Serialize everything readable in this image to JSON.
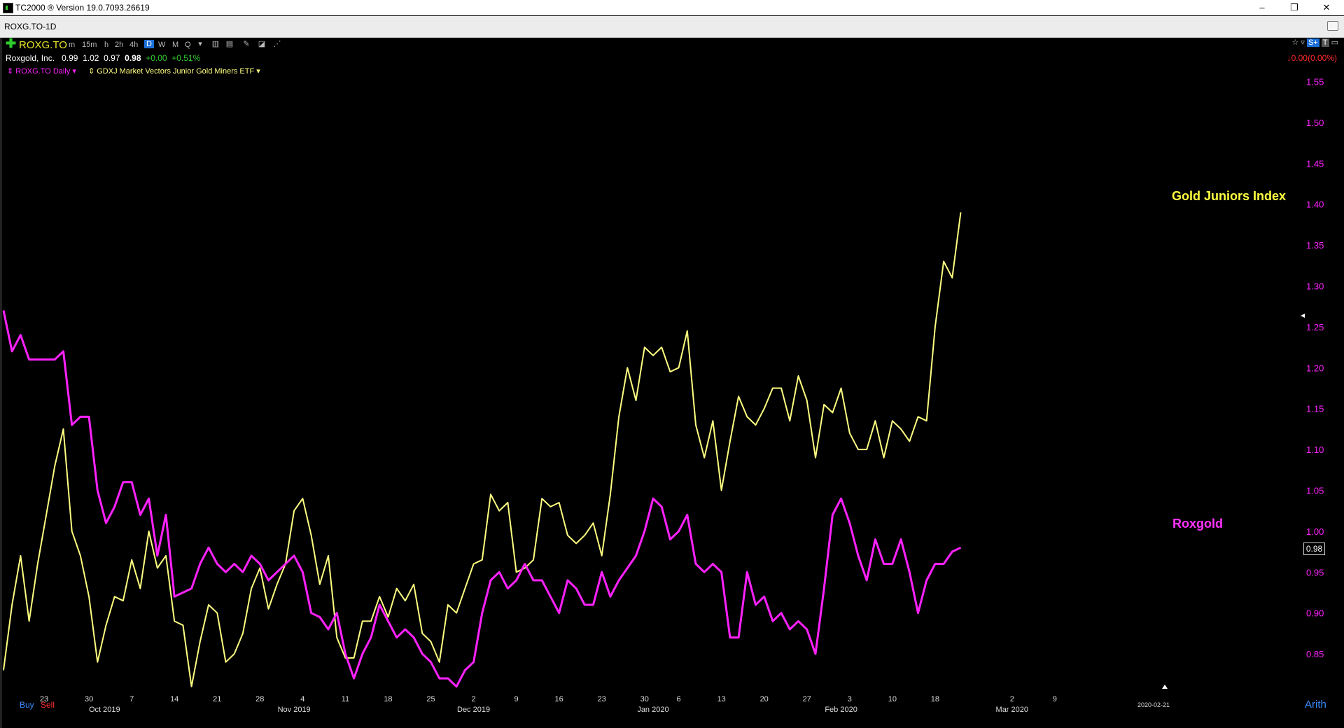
{
  "window": {
    "title": "TC2000 ® Version 19.0.7093.26619",
    "controls": [
      "–",
      "❐",
      "✕"
    ]
  },
  "tab": {
    "label": "ROXG.TO-1D"
  },
  "toolbar": {
    "symbol": "ROXG.TO",
    "timeframes": [
      "m",
      "15m",
      "h",
      "2h",
      "4h",
      "D",
      "W",
      "M",
      "Q"
    ],
    "active_timeframe": "D"
  },
  "quote": {
    "name": "Roxgold, Inc.",
    "open": "0.99",
    "high": "1.02",
    "low": "0.97",
    "last": "0.98",
    "change": "+0.00",
    "change_pct": "+0.51%",
    "neg_change": "↓0.00(0.00%)"
  },
  "legend": {
    "series1": "ROXG.TO Daily",
    "series2": "GDXJ Market Vectors Junior Gold Miners ETF"
  },
  "annotations": {
    "gold_label": "Gold Juniors Index",
    "rox_label": "Roxgold",
    "price_box": "0.98",
    "date_marker": "2020-02-21"
  },
  "footer": {
    "buy": "Buy",
    "sell": "Sell",
    "scale": "Arith"
  },
  "colors": {
    "roxgold": "#ff22ff",
    "gdxj": "#ffff80",
    "background": "#000000",
    "gold_label": "#ffff40"
  },
  "chart_data": {
    "type": "line",
    "ylim": [
      0.8,
      1.58
    ],
    "y_ticks": [
      "1.55",
      "1.50",
      "1.45",
      "1.40",
      "1.35",
      "1.30",
      "1.25",
      "1.20",
      "1.15",
      "1.10",
      "1.05",
      "1.00",
      "0.95",
      "0.90",
      "0.85"
    ],
    "x_tick_labels": [
      {
        "label": "23",
        "i": 5
      },
      {
        "label": "30",
        "i": 10
      },
      {
        "label": "7",
        "i": 15
      },
      {
        "label": "14",
        "i": 20
      },
      {
        "label": "21",
        "i": 25
      },
      {
        "label": "28",
        "i": 30
      },
      {
        "label": "4",
        "i": 35
      },
      {
        "label": "11",
        "i": 40
      },
      {
        "label": "18",
        "i": 45
      },
      {
        "label": "25",
        "i": 50
      },
      {
        "label": "2",
        "i": 55
      },
      {
        "label": "9",
        "i": 60
      },
      {
        "label": "16",
        "i": 65
      },
      {
        "label": "23",
        "i": 70
      },
      {
        "label": "30",
        "i": 75
      },
      {
        "label": "6",
        "i": 79
      },
      {
        "label": "13",
        "i": 84
      },
      {
        "label": "20",
        "i": 89
      },
      {
        "label": "27",
        "i": 94
      },
      {
        "label": "3",
        "i": 99
      },
      {
        "label": "10",
        "i": 104
      },
      {
        "label": "18",
        "i": 109
      },
      {
        "label": "2",
        "i": 118
      },
      {
        "label": "9",
        "i": 123
      }
    ],
    "month_labels": [
      {
        "label": "Oct 2019",
        "i": 11
      },
      {
        "label": "Nov 2019",
        "i": 34
      },
      {
        "label": "Dec 2019",
        "i": 55
      },
      {
        "label": "Jan 2020",
        "i": 76
      },
      {
        "label": "Feb 2020",
        "i": 98
      },
      {
        "label": "Mar 2020",
        "i": 118
      }
    ],
    "series": [
      {
        "name": "ROXG.TO Daily",
        "color": "#ff22ff",
        "values": [
          1.27,
          1.22,
          1.24,
          1.21,
          1.21,
          1.21,
          1.21,
          1.22,
          1.13,
          1.14,
          1.14,
          1.05,
          1.01,
          1.03,
          1.06,
          1.06,
          1.02,
          1.04,
          0.97,
          1.02,
          0.92,
          0.925,
          0.93,
          0.96,
          0.98,
          0.96,
          0.95,
          0.96,
          0.95,
          0.97,
          0.96,
          0.94,
          0.95,
          0.96,
          0.97,
          0.95,
          0.9,
          0.895,
          0.88,
          0.9,
          0.85,
          0.82,
          0.85,
          0.87,
          0.91,
          0.89,
          0.87,
          0.88,
          0.87,
          0.85,
          0.84,
          0.82,
          0.82,
          0.81,
          0.83,
          0.84,
          0.9,
          0.94,
          0.95,
          0.93,
          0.94,
          0.96,
          0.94,
          0.94,
          0.92,
          0.9,
          0.94,
          0.93,
          0.91,
          0.91,
          0.95,
          0.92,
          0.94,
          0.955,
          0.97,
          1.0,
          1.04,
          1.03,
          0.99,
          1.0,
          1.02,
          0.96,
          0.95,
          0.96,
          0.95,
          0.87,
          0.87,
          0.95,
          0.91,
          0.92,
          0.89,
          0.9,
          0.88,
          0.89,
          0.88,
          0.85,
          0.93,
          1.02,
          1.04,
          1.01,
          0.97,
          0.94,
          0.99,
          0.96,
          0.96,
          0.99,
          0.95,
          0.9,
          0.94,
          0.96,
          0.96,
          0.975,
          0.98
        ]
      },
      {
        "name": "GDXJ Market Vectors Junior Gold Miners ETF",
        "color": "#ffff80",
        "values": [
          0.83,
          0.91,
          0.97,
          0.89,
          0.96,
          1.02,
          1.08,
          1.125,
          1.0,
          0.97,
          0.92,
          0.84,
          0.885,
          0.92,
          0.915,
          0.965,
          0.93,
          1.0,
          0.955,
          0.97,
          0.89,
          0.885,
          0.81,
          0.865,
          0.91,
          0.9,
          0.84,
          0.85,
          0.875,
          0.93,
          0.955,
          0.905,
          0.935,
          0.96,
          1.025,
          1.04,
          0.995,
          0.935,
          0.97,
          0.87,
          0.845,
          0.845,
          0.89,
          0.89,
          0.92,
          0.895,
          0.93,
          0.915,
          0.935,
          0.875,
          0.865,
          0.84,
          0.91,
          0.9,
          0.93,
          0.96,
          0.965,
          1.045,
          1.025,
          1.035,
          0.95,
          0.955,
          0.965,
          1.04,
          1.03,
          1.035,
          0.995,
          0.985,
          0.995,
          1.01,
          0.97,
          1.045,
          1.14,
          1.2,
          1.16,
          1.225,
          1.215,
          1.225,
          1.195,
          1.2,
          1.245,
          1.13,
          1.09,
          1.135,
          1.05,
          1.11,
          1.165,
          1.14,
          1.13,
          1.15,
          1.175,
          1.175,
          1.135,
          1.19,
          1.16,
          1.09,
          1.155,
          1.145,
          1.175,
          1.12,
          1.1,
          1.1,
          1.135,
          1.09,
          1.135,
          1.125,
          1.11,
          1.14,
          1.135,
          1.25,
          1.33,
          1.31,
          1.39
        ]
      }
    ]
  }
}
